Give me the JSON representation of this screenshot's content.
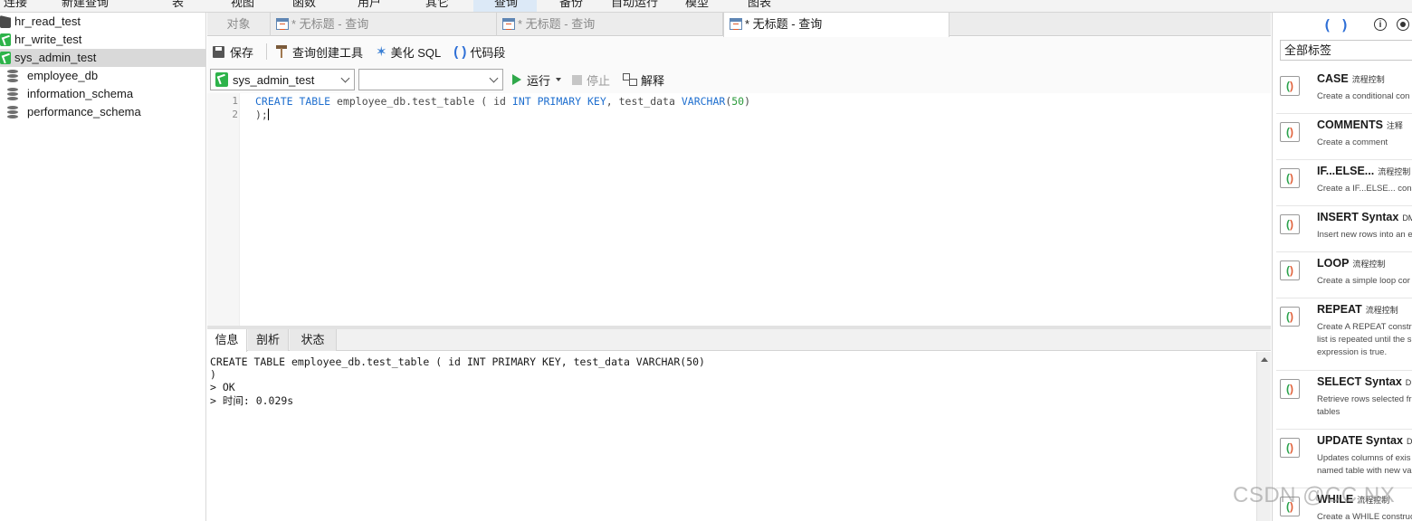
{
  "ribbon": {
    "items": [
      "连接",
      "新建查询",
      "表",
      "视图",
      "函数",
      "用户",
      "其它",
      "查询",
      "备份",
      "自动运行",
      "模型",
      "图表"
    ],
    "active": "查询"
  },
  "nav": {
    "connections": [
      {
        "label": "hr_read_test",
        "icon": "connection-gray-icon"
      },
      {
        "label": "hr_write_test",
        "icon": "connection-green-icon"
      },
      {
        "label": "sys_admin_test",
        "icon": "connection-green-icon",
        "selected": true
      }
    ],
    "databases": [
      "employee_db",
      "information_schema",
      "performance_schema"
    ]
  },
  "tabs": {
    "objects": "对象",
    "queries": [
      {
        "label": "* 无标题 - 查询",
        "active": false
      },
      {
        "label": "* 无标题 - 查询",
        "active": false
      },
      {
        "label": "* 无标题 - 查询",
        "active": true
      }
    ]
  },
  "toolbar": {
    "save": "保存",
    "query_builder": "查询创建工具",
    "beautify": "美化 SQL",
    "snippet": "代码段",
    "connection_value": "sys_admin_test",
    "database_value": "",
    "run": "运行",
    "stop": "停止",
    "explain": "解释"
  },
  "editor": {
    "line_numbers": [
      "1",
      "2"
    ],
    "line1": {
      "kw1": "CREATE TABLE",
      "t1": " employee_db.test_table ( id ",
      "kw2": "INT PRIMARY KEY",
      "t2": ", test_data ",
      "kw3": "VARCHAR",
      "p1": "(",
      "n1": "50",
      "p2": ")"
    },
    "line2": ");"
  },
  "result_tabs": [
    "信息",
    "剖析",
    "状态"
  ],
  "messages": [
    "CREATE TABLE employee_db.test_table ( id INT PRIMARY KEY, test_data VARCHAR(50)",
    ")",
    "> OK",
    "> 时间: 0.029s"
  ],
  "right_panel": {
    "tag_filter": "全部标签",
    "snippets": [
      {
        "title": "CASE",
        "tag": "流程控制",
        "desc": [
          "Create a conditional con"
        ]
      },
      {
        "title": "COMMENTS",
        "tag": "注释",
        "desc": [
          "Create a comment"
        ]
      },
      {
        "title": "IF...ELSE...",
        "tag": "流程控制",
        "desc": [
          "Create a IF...ELSE... const"
        ]
      },
      {
        "title": "INSERT Syntax",
        "tag": "DM",
        "desc": [
          "Insert new rows into an e"
        ]
      },
      {
        "title": "LOOP",
        "tag": "流程控制",
        "desc": [
          "Create a simple loop cor"
        ]
      },
      {
        "title": "REPEAT",
        "tag": "流程控制",
        "desc": [
          "Create A REPEAT constru",
          "list is repeated until the s",
          "expression is true."
        ]
      },
      {
        "title": "SELECT Syntax",
        "tag": "DM",
        "desc": [
          "Retrieve rows selected fr",
          "tables"
        ]
      },
      {
        "title": "UPDATE Syntax",
        "tag": "D",
        "desc": [
          "Updates columns of exis",
          "named table with new va"
        ]
      },
      {
        "title": "WHILE",
        "tag": "流程控制",
        "desc": [
          "Create a WHILE construc"
        ]
      }
    ]
  },
  "watermark": "CSDN @CC NX"
}
